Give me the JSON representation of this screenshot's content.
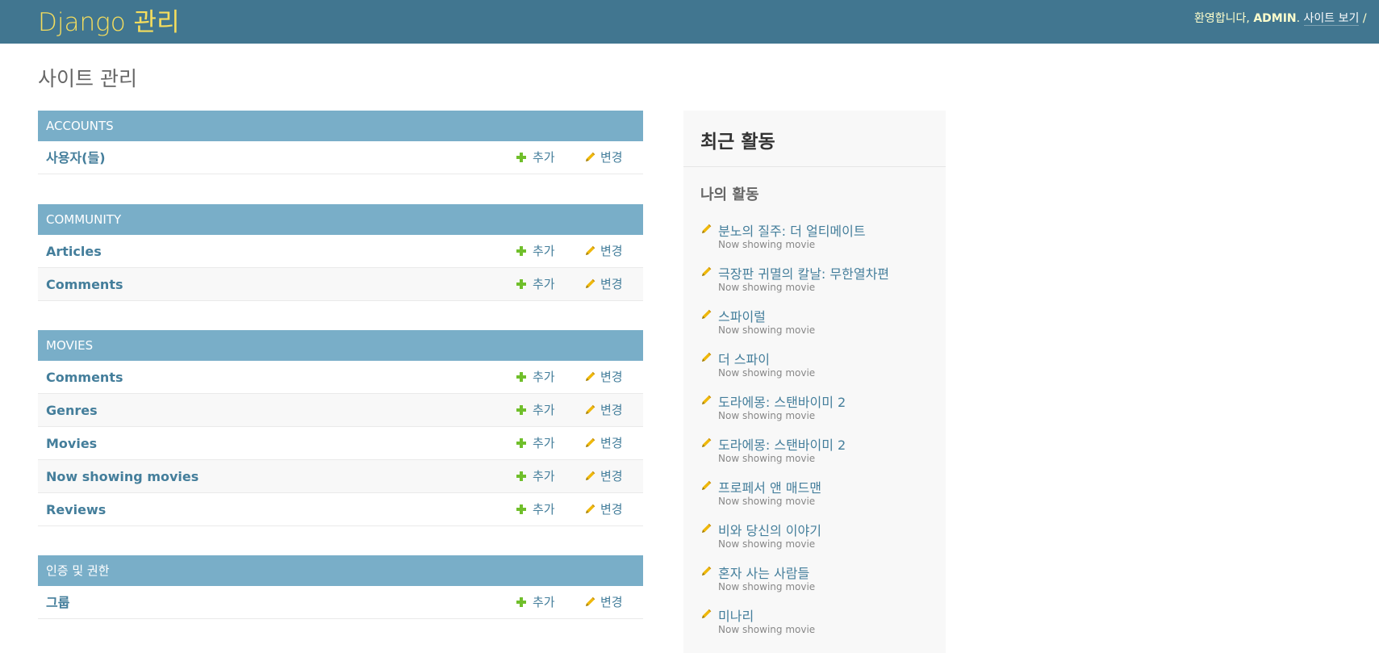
{
  "header": {
    "brand": "Django 관리",
    "welcome": "환영합니다,",
    "username": "ADMIN",
    "separator": ".",
    "view_site": "사이트 보기",
    "divider": "/"
  },
  "page_title": "사이트 관리",
  "add_label": "추가",
  "change_label": "변경",
  "apps": [
    {
      "caption": "ACCOUNTS",
      "models": [
        "사용자(들)"
      ]
    },
    {
      "caption": "COMMUNITY",
      "models": [
        "Articles",
        "Comments"
      ]
    },
    {
      "caption": "MOVIES",
      "models": [
        "Comments",
        "Genres",
        "Movies",
        "Now showing movies",
        "Reviews"
      ]
    },
    {
      "caption": "인증 및 권한",
      "models": [
        "그룹"
      ]
    }
  ],
  "recent_actions": {
    "title": "최근 활동",
    "subtitle": "나의 활동",
    "items": [
      {
        "label": "분노의 질주: 더 얼티메이트",
        "type": "Now showing movie"
      },
      {
        "label": "극장판 귀멸의 칼날: 무한열차편",
        "type": "Now showing movie"
      },
      {
        "label": "스파이럴",
        "type": "Now showing movie"
      },
      {
        "label": "더 스파이",
        "type": "Now showing movie"
      },
      {
        "label": "도라에몽: 스탠바이미 2",
        "type": "Now showing movie"
      },
      {
        "label": "도라에몽: 스탠바이미 2",
        "type": "Now showing movie"
      },
      {
        "label": "프로페서 앤 매드맨",
        "type": "Now showing movie"
      },
      {
        "label": "비와 당신의 이야기",
        "type": "Now showing movie"
      },
      {
        "label": "혼자 사는 사람들",
        "type": "Now showing movie"
      },
      {
        "label": "미나리",
        "type": "Now showing movie"
      }
    ]
  },
  "colors": {
    "header_bg": "#417690",
    "brand": "#f5dd5d",
    "module_caption_bg": "#79aec8",
    "link": "#447e9b",
    "add_icon": "#70bf2b",
    "change_icon": "#efb80b"
  },
  "icons": {
    "add": "plus-icon",
    "change": "pencil-icon"
  }
}
